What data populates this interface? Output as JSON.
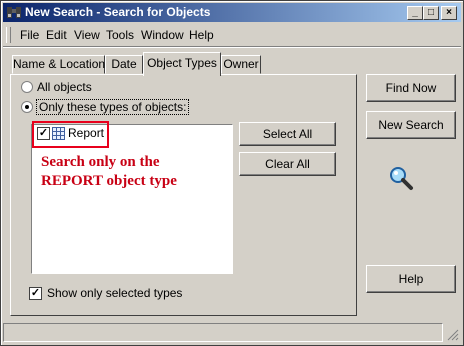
{
  "window": {
    "title": "New Search - Search for Objects"
  },
  "titlebar_buttons": {
    "minimize": "_",
    "maximize": "□",
    "close": "×"
  },
  "menu": [
    "File",
    "Edit",
    "View",
    "Tools",
    "Window",
    "Help"
  ],
  "tabs": [
    "Name & Location",
    "Date",
    "Object Types",
    "Owner"
  ],
  "active_tab": "Object Types",
  "options": {
    "all_objects": "All objects",
    "only_types": "Only these types of objects:",
    "selected": "only_types"
  },
  "type_list": [
    {
      "label": "Report",
      "checked": true
    }
  ],
  "buttons": {
    "select_all": "Select All",
    "clear_all": "Clear All",
    "find_now": "Find Now",
    "new_search": "New Search",
    "help": "Help"
  },
  "show_selected": {
    "label": "Show only selected types",
    "checked": true
  },
  "annotation": [
    "Search only on the",
    "REPORT object type"
  ],
  "icons": {
    "app": "binoculars-icon",
    "search": "magnifier-icon",
    "report": "report-grid-icon"
  },
  "colors": {
    "title_start": "#0a246a",
    "title_end": "#a6caf0",
    "annotation": "#c80014",
    "highlight": "#e8001c"
  }
}
